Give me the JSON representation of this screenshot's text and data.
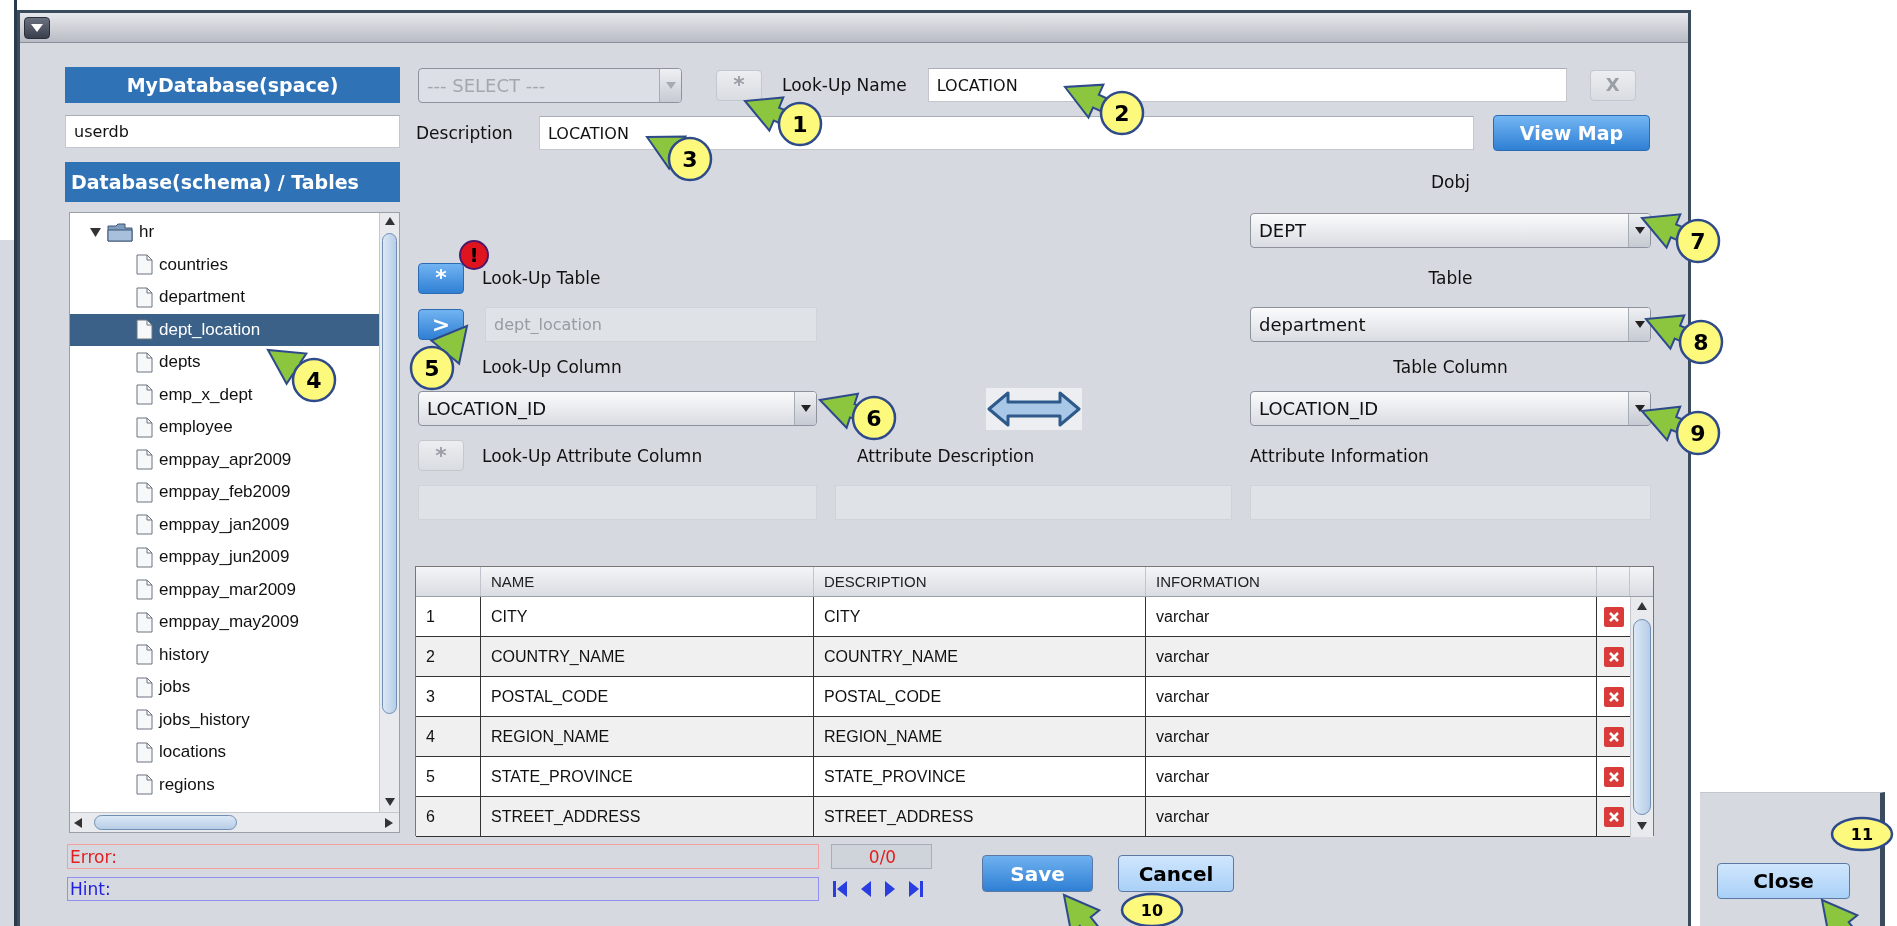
{
  "left_panel": {
    "space_header": "MyDatabase(space)",
    "space_field": {
      "value": "userdb"
    },
    "tree_header": "Database(schema) / Tables",
    "tree": [
      {
        "label": "hr",
        "expanded": true,
        "children": [
          {
            "label": "countries",
            "selected": false
          },
          {
            "label": "department",
            "selected": false
          },
          {
            "label": "dept_location",
            "selected": true
          },
          {
            "label": "depts",
            "selected": false
          },
          {
            "label": "emp_x_dept",
            "selected": false
          },
          {
            "label": "employee",
            "selected": false
          },
          {
            "label": "emppay_apr2009",
            "selected": false
          },
          {
            "label": "emppay_feb2009",
            "selected": false
          },
          {
            "label": "emppay_jan2009",
            "selected": false
          },
          {
            "label": "emppay_jun2009",
            "selected": false
          },
          {
            "label": "emppay_mar2009",
            "selected": false
          },
          {
            "label": "emppay_may2009",
            "selected": false
          },
          {
            "label": "history",
            "selected": false
          },
          {
            "label": "jobs",
            "selected": false
          },
          {
            "label": "jobs_history",
            "selected": false
          },
          {
            "label": "locations",
            "selected": false
          },
          {
            "label": "regions",
            "selected": false
          }
        ]
      }
    ]
  },
  "lookup_header": {
    "schema_select": {
      "placeholder": "--- SELECT ---",
      "disabled": true
    },
    "add_button": {
      "label": "*",
      "disabled": true
    },
    "name_label": "Look-Up Name",
    "name_field": {
      "value": "LOCATION"
    },
    "clear_button": {
      "label": "X",
      "disabled": true
    },
    "description_label": "Description",
    "description_field": {
      "value": "LOCATION"
    },
    "view_map_button": "View Map"
  },
  "lookup_side": {
    "table_button": {
      "label": "*",
      "disabled": false
    },
    "warning_badge": "!",
    "table_label": "Look-Up Table",
    "pick_button": {
      "label": ">",
      "disabled": false
    },
    "table_field": {
      "value": "dept_location",
      "disabled": true
    },
    "column_label": "Look-Up Column",
    "column_select": {
      "value": "LOCATION_ID"
    },
    "attribute_button": {
      "label": "*",
      "disabled": true
    },
    "attribute_label": "Look-Up Attribute Column"
  },
  "mapping_side": {
    "dobj_label": "Dobj",
    "dobj_select": {
      "value": "DEPT"
    },
    "table_label": "Table",
    "table_select": {
      "value": "department"
    },
    "column_label": "Table Column",
    "column_select": {
      "value": "LOCATION_ID"
    }
  },
  "attribute_description_label": "Attribute Description",
  "attribute_information_label": "Attribute Information",
  "table": {
    "columns": [
      "NAME",
      "DESCRIPTION",
      "INFORMATION"
    ],
    "rows": [
      {
        "index": "1",
        "name": "CITY",
        "description": "CITY",
        "information": "varchar"
      },
      {
        "index": "2",
        "name": "COUNTRY_NAME",
        "description": "COUNTRY_NAME",
        "information": "varchar"
      },
      {
        "index": "3",
        "name": "POSTAL_CODE",
        "description": "POSTAL_CODE",
        "information": "varchar"
      },
      {
        "index": "4",
        "name": "REGION_NAME",
        "description": "REGION_NAME",
        "information": "varchar"
      },
      {
        "index": "5",
        "name": "STATE_PROVINCE",
        "description": "STATE_PROVINCE",
        "information": "varchar"
      },
      {
        "index": "6",
        "name": "STREET_ADDRESS",
        "description": "STREET_ADDRESS",
        "information": "varchar"
      }
    ]
  },
  "status": {
    "error_label": "Error:",
    "counter": "0/0",
    "hint_label": "Hint:"
  },
  "buttons": [
    {
      "label": "Save",
      "kind": "primary"
    },
    {
      "label": "Cancel",
      "kind": "secondary"
    }
  ],
  "background_window": {
    "close_button": "Close"
  },
  "callouts": [
    {
      "number": "1",
      "kind": "circle"
    },
    {
      "number": "2",
      "kind": "circle"
    },
    {
      "number": "3",
      "kind": "circle"
    },
    {
      "number": "4",
      "kind": "circle"
    },
    {
      "number": "5",
      "kind": "circle"
    },
    {
      "number": "6",
      "kind": "circle"
    },
    {
      "number": "7",
      "kind": "circle"
    },
    {
      "number": "8",
      "kind": "circle"
    },
    {
      "number": "9",
      "kind": "circle"
    },
    {
      "number": "10",
      "kind": "ellipse"
    },
    {
      "number": "11",
      "kind": "ellipse"
    }
  ]
}
